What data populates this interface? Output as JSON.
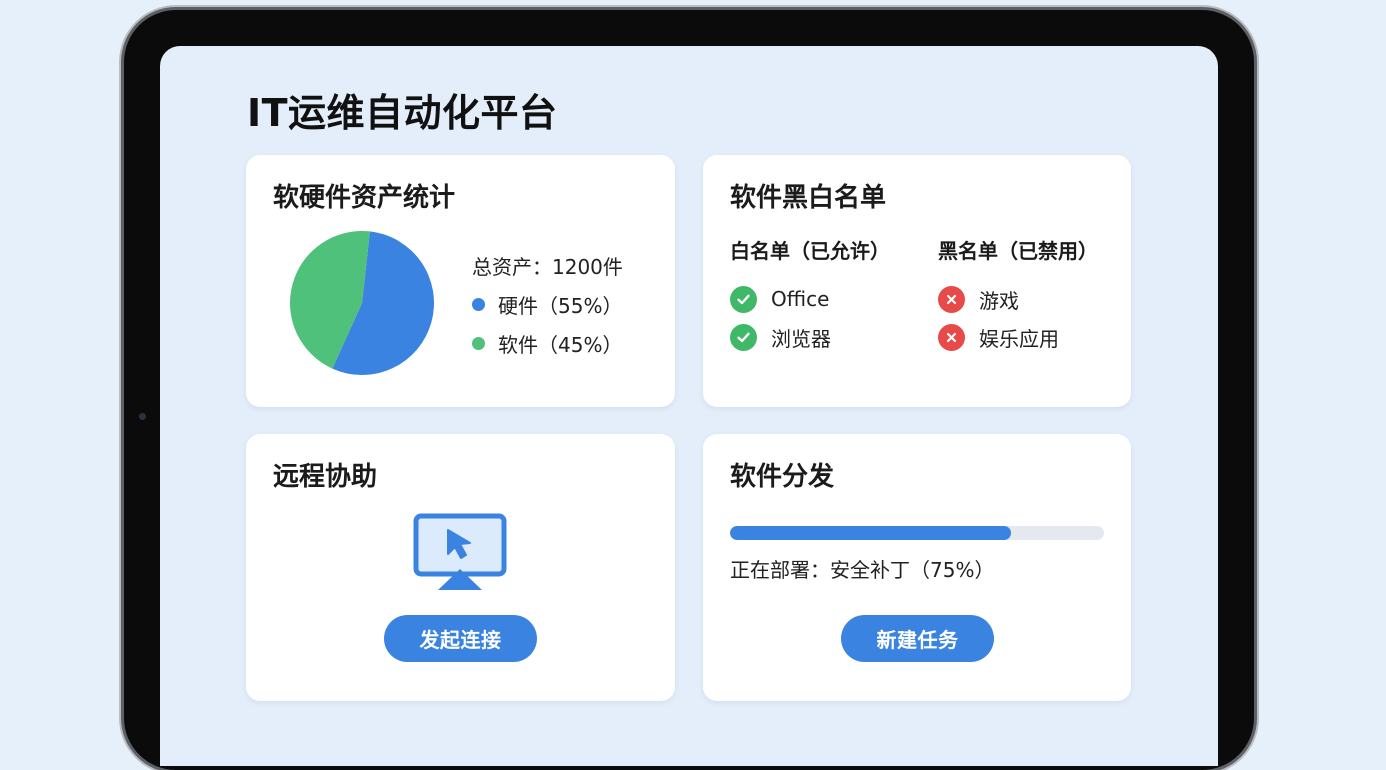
{
  "page": {
    "title": "IT运维自动化平台"
  },
  "colors": {
    "accent": "#3a83e0",
    "hardware": "#3a83e0",
    "software": "#4fc17a",
    "allowed": "#3fb868",
    "blocked": "#e84a4a",
    "track": "#e4e9f0"
  },
  "assets": {
    "title": "软硬件资产统计",
    "total": "总资产：1200件",
    "legend": [
      {
        "label": "硬件（55%）",
        "color": "#3a83e0"
      },
      {
        "label": "软件（45%）",
        "color": "#4fc17a"
      }
    ],
    "chart_data": {
      "type": "pie",
      "categories": [
        "硬件",
        "软件"
      ],
      "values": [
        55,
        45
      ],
      "colors": [
        "#3a83e0",
        "#4fc17a"
      ]
    }
  },
  "lists": {
    "title": "软件黑白名单",
    "whitelist": {
      "header": "白名单（已允许）",
      "icon": "check-icon",
      "items": [
        "Office",
        "浏览器"
      ]
    },
    "blacklist": {
      "header": "黑名单（已禁用）",
      "icon": "cross-icon",
      "items": [
        "游戏",
        "娱乐应用"
      ]
    }
  },
  "remote": {
    "title": "远程协助",
    "icon": "remote-desktop-icon",
    "button_label": "发起连接"
  },
  "deploy": {
    "title": "软件分发",
    "progress": 0.75,
    "status": "正在部署：安全补丁（75%）",
    "button_label": "新建任务"
  }
}
